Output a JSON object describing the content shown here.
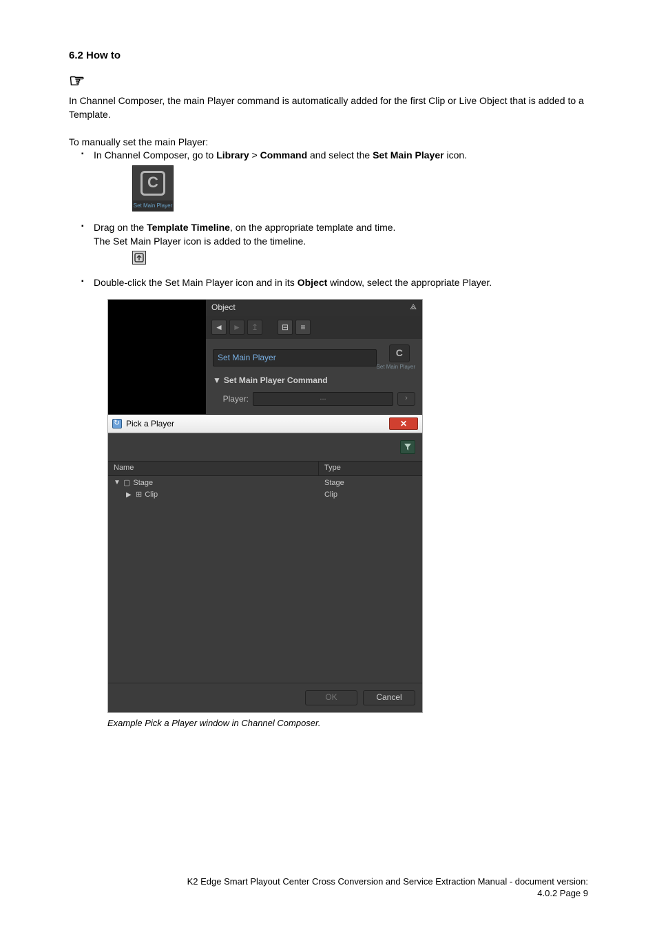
{
  "heading": "6.2    How to",
  "intro": "In Channel Composer, the main Player command is automatically added for the first Clip or Live Object that is added to a Template.",
  "manual_lead": "To manually set the main Player:",
  "bullet1": {
    "pre": "In Channel Composer, go to ",
    "b1": "Library",
    "mid1": " > ",
    "b2": "Command",
    "mid2": " and select the ",
    "b3": "Set Main Player",
    "post": " icon."
  },
  "smp_icon_label": "Set Main Player",
  "bullet2": {
    "pre": "Drag on the ",
    "b1": "Template Timeline",
    "post": ", on the appropriate template and time."
  },
  "bullet2_line2": "The Set Main Player icon is added to the timeline.",
  "bullet3": {
    "pre": "Double-click the Set Main Player icon and in its ",
    "b1": "Object",
    "post": " window, select the appropriate Player."
  },
  "object_panel": {
    "title": "Object",
    "name_value": "Set Main Player",
    "thumb_label": "Set Main Player",
    "section_title": "Set Main Player Command",
    "prop_label": "Player:",
    "prop_value": "..."
  },
  "picker": {
    "title": "Pick a Player",
    "col_name": "Name",
    "col_type": "Type",
    "rows": [
      {
        "indent": 0,
        "caret": "▼",
        "icon": "▢",
        "name": "Stage",
        "type": "Stage"
      },
      {
        "indent": 1,
        "caret": "▶",
        "icon": "⊞",
        "name": "Clip",
        "type": "Clip"
      }
    ],
    "ok": "OK",
    "cancel": "Cancel"
  },
  "caption": "Example Pick a Player window in Channel Composer.",
  "footer_line1": "K2 Edge Smart Playout Center Cross Conversion and Service Extraction Manual - document version:",
  "footer_line2": "4.0.2 Page 9"
}
